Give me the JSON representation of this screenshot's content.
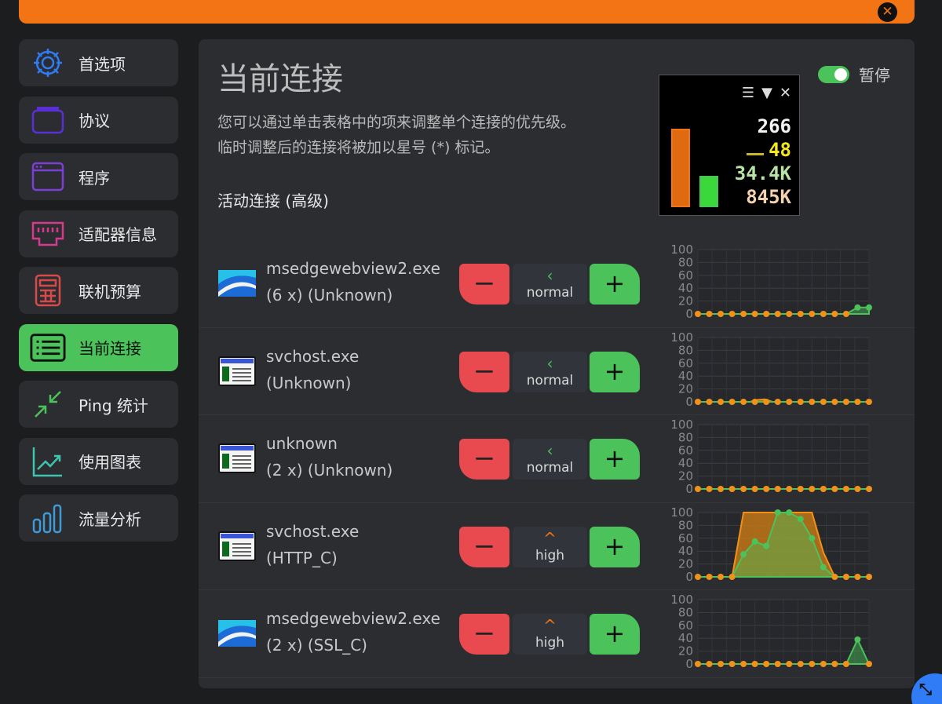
{
  "window": {
    "close_symbol": "✕"
  },
  "sidebar": {
    "items": [
      {
        "label": "首选项",
        "icon": "gear-icon",
        "color": "#2f7cf6"
      },
      {
        "label": "协议",
        "icon": "protocol-icon",
        "color": "#5a2fd6"
      },
      {
        "label": "程序",
        "icon": "window-icon",
        "color": "#7c3fd6"
      },
      {
        "label": "适配器信息",
        "icon": "ethernet-port-icon",
        "color": "#d63a8c"
      },
      {
        "label": "联机预算",
        "icon": "calculator-icon",
        "color": "#d64a4a"
      },
      {
        "label": "当前连接",
        "icon": "list-icon",
        "color": "#111111",
        "active": true
      },
      {
        "label": "Ping 统计",
        "icon": "ping-arrows-icon",
        "color": "#4cc25a"
      },
      {
        "label": "使用图表",
        "icon": "line-chart-icon",
        "color": "#3fc4b0"
      },
      {
        "label": "流量分析",
        "icon": "bar-chart-icon",
        "color": "#3f9ad6"
      }
    ]
  },
  "main": {
    "title": "当前连接",
    "description_line1": "您可以通过单击表格中的项来调整单个连接的优先级。",
    "description_line2": "临时调整后的连接将被加以星号 (*) 标记。",
    "section_title": "活动连接 (高级)",
    "pause_label": "暂停",
    "pause_on": true
  },
  "meter": {
    "values": [
      "266",
      "48",
      "34.4K",
      "845K"
    ],
    "colors": {
      "accent": "#f27414",
      "green": "#4cc25a"
    }
  },
  "connections": [
    {
      "name": "msedgewebview2.exe",
      "detail": "(6 x) (Unknown)",
      "icon": "edge-webview-icon",
      "priority": "normal",
      "arrow": "‹"
    },
    {
      "name": "svchost.exe",
      "detail": "(Unknown)",
      "icon": "window-app-icon",
      "priority": "normal",
      "arrow": "‹"
    },
    {
      "name": "unknown",
      "detail": "(2 x) (Unknown)",
      "icon": "window-app-icon",
      "priority": "normal",
      "arrow": "‹"
    },
    {
      "name": "svchost.exe",
      "detail": "(HTTP_C)",
      "icon": "window-app-icon",
      "priority": "high",
      "arrow": "^"
    },
    {
      "name": "msedgewebview2.exe",
      "detail": "(2 x) (SSL_C)",
      "icon": "edge-webview-icon",
      "priority": "high",
      "arrow": "^"
    }
  ],
  "buttons": {
    "minus": "−",
    "plus": "+"
  },
  "chart_data": [
    {
      "type": "area",
      "ylim": [
        0,
        100
      ],
      "yticks": [
        "100",
        "80",
        "60",
        "40",
        "20",
        "0"
      ],
      "series": [
        {
          "values": [
            0,
            0,
            0,
            0,
            0,
            0,
            0,
            0,
            0,
            0,
            0,
            0,
            0,
            0,
            10,
            10
          ]
        },
        {
          "values": [
            0,
            0,
            0,
            0,
            0,
            0,
            0,
            0,
            0,
            0,
            0,
            0,
            0,
            0,
            0,
            0
          ]
        }
      ]
    },
    {
      "type": "area",
      "ylim": [
        0,
        100
      ],
      "yticks": [
        "100",
        "80",
        "60",
        "40",
        "20",
        "0"
      ],
      "series": [
        {
          "values": [
            0,
            0,
            0,
            0,
            0,
            0,
            0,
            0,
            0,
            0,
            0,
            0,
            0,
            0,
            0,
            0
          ]
        },
        {
          "values": [
            0,
            0,
            0,
            0,
            0,
            0,
            0,
            0,
            3,
            4,
            0,
            0,
            0,
            0,
            0,
            0,
            0,
            0,
            0,
            0,
            0,
            0,
            0,
            0
          ]
        }
      ]
    },
    {
      "type": "area",
      "ylim": [
        0,
        100
      ],
      "yticks": [
        "100",
        "80",
        "60",
        "40",
        "20",
        "0"
      ],
      "series": [
        {
          "values": [
            0,
            0,
            0,
            0,
            0,
            0,
            0,
            0,
            0,
            0,
            0,
            0,
            0,
            0,
            0,
            0
          ]
        },
        {
          "values": [
            0,
            0,
            0,
            0,
            0,
            0,
            0,
            0,
            0,
            0,
            0,
            0,
            0,
            0,
            0,
            0
          ]
        }
      ]
    },
    {
      "type": "area",
      "ylim": [
        0,
        100
      ],
      "yticks": [
        "100",
        "80",
        "60",
        "40",
        "20",
        "0"
      ],
      "series": [
        {
          "values": [
            0,
            0,
            0,
            0,
            35,
            55,
            48,
            100,
            100,
            90,
            60,
            15,
            0,
            0,
            0,
            0
          ]
        },
        {
          "values": [
            0,
            0,
            0,
            0,
            100,
            100,
            100,
            100,
            100,
            100,
            100,
            38,
            0,
            0,
            0,
            0
          ]
        }
      ]
    },
    {
      "type": "area",
      "ylim": [
        0,
        100
      ],
      "yticks": [
        "100",
        "80",
        "60",
        "40",
        "20",
        "0"
      ],
      "series": [
        {
          "values": [
            0,
            0,
            0,
            0,
            0,
            0,
            0,
            0,
            0,
            0,
            0,
            0,
            0,
            0,
            38,
            0
          ]
        },
        {
          "values": [
            0,
            0,
            0,
            0,
            0,
            0,
            0,
            0,
            0,
            0,
            0,
            0,
            0,
            0,
            0,
            0
          ]
        }
      ]
    }
  ]
}
